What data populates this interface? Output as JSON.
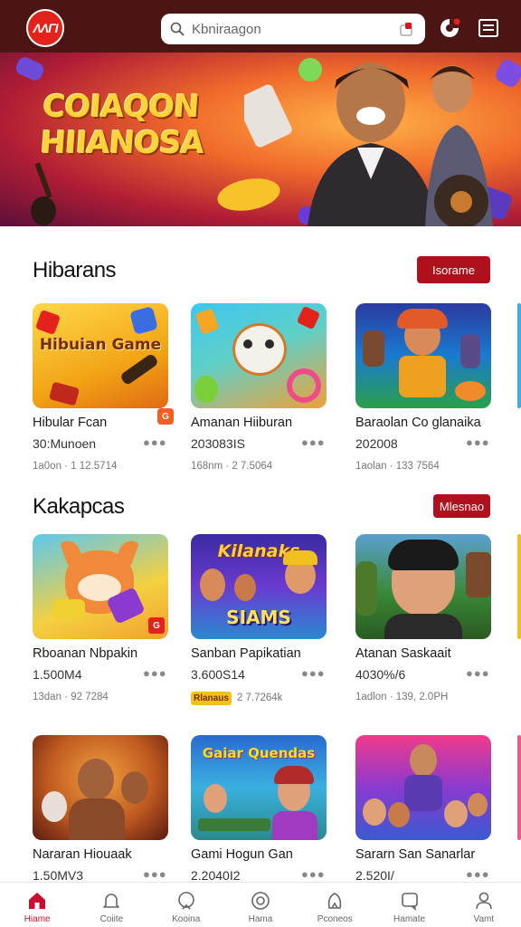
{
  "header": {
    "logo_text": "ΛΛΓΙ",
    "search_placeholder": "Kbniraagon"
  },
  "banner": {
    "title_line1": "COIAQON",
    "title_line2": "HIIANOSA"
  },
  "sections": [
    {
      "title": "Hibarans",
      "button": "Isorame",
      "cards": [
        {
          "name": "Hibular Fcan",
          "count": "30:Munoen",
          "meta": "1a0on · 1 12.5714",
          "thumb_text": "Hibuian Game",
          "badge": "G"
        },
        {
          "name": "Amanan Hiiburan",
          "count": "203083IS",
          "meta": "168nm · 2 7.5064",
          "thumb_text": ""
        },
        {
          "name": "Baraolan Co glanaika",
          "count": "202008",
          "meta": "1aolan · 133 7564",
          "thumb_text": ""
        }
      ]
    },
    {
      "title": "Kakapcas",
      "button": "Mlesnao",
      "cards": [
        {
          "name": "Rboanan Nbpakin",
          "count": "1.500M4",
          "meta": "13dan · 92 7284",
          "thumb_text": "",
          "badge": "G"
        },
        {
          "name": "Sanban Papikatian",
          "count": "3.600S14",
          "meta": "2 7.7264k",
          "thumb_text": "Kilanaks",
          "thumb_sub": "SIAMS",
          "tag": "Rlanaus"
        },
        {
          "name": "Atanan Saskaait",
          "count": "4030%/6",
          "meta": "1adlon · 139, 2.0PH",
          "thumb_text": ""
        }
      ]
    },
    {
      "title": "",
      "button": "",
      "cards": [
        {
          "name": "Nararan Hiouaak",
          "count": "1.50MV3",
          "meta": "",
          "thumb_text": ""
        },
        {
          "name": "Gami Hogun Gan",
          "count": "2.2040I2",
          "meta": "",
          "thumb_text": "Gaiar Quendas"
        },
        {
          "name": "Sararn San Sanarlar",
          "count": "2.520I/",
          "meta": "",
          "thumb_text": ""
        }
      ]
    }
  ],
  "bottom_nav": [
    {
      "label": "Hiame",
      "icon": "home-icon",
      "active": true
    },
    {
      "label": "Coiite",
      "icon": "bell-icon",
      "active": false
    },
    {
      "label": "Kooina",
      "icon": "heart-icon",
      "active": false
    },
    {
      "label": "Hama",
      "icon": "compass-icon",
      "active": false
    },
    {
      "label": "Pconeos",
      "icon": "bag-icon",
      "active": false
    },
    {
      "label": "Hamate",
      "icon": "chat-icon",
      "active": false
    },
    {
      "label": "Vamt",
      "icon": "user-icon",
      "active": false
    }
  ],
  "colors": {
    "header_bg": "#4a1512",
    "accent": "#b0101c",
    "active_nav": "#c8102e"
  }
}
